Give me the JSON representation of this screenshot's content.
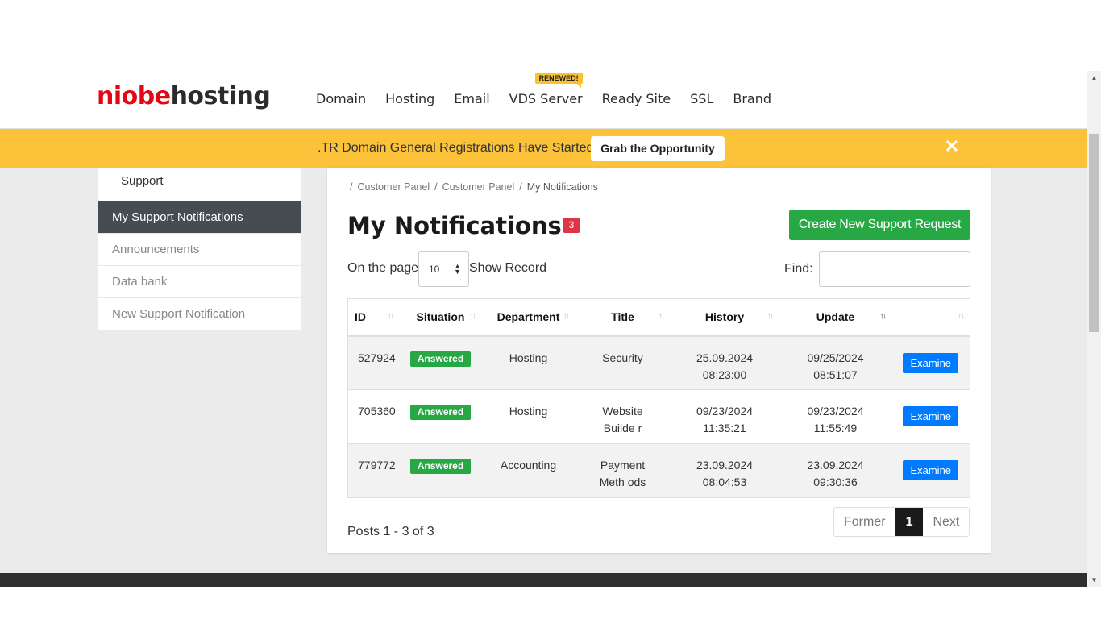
{
  "logo": {
    "part1": "niobe",
    "part2": "hosting"
  },
  "nav": {
    "items": [
      "Domain",
      "Hosting",
      "Email",
      "VDS Server",
      "Ready Site",
      "SSL",
      "Brand"
    ],
    "badge": "RENEWED!"
  },
  "promo": {
    "text": ".TR Domain General Registrations Have Started",
    "button": "Grab the Opportunity",
    "close": "✕"
  },
  "sidebar": {
    "support": "Support",
    "items": [
      "My Support Notifications",
      "Announcements",
      "Data bank",
      "New Support Notification"
    ]
  },
  "breadcrumb": [
    "Customer Panel",
    "Customer Panel",
    "My Notifications"
  ],
  "page": {
    "title": "My Notifications",
    "count": "3",
    "create_button": "Create New Support Request",
    "length_label": "On the page",
    "length_value": "10",
    "length_after": "Show Record",
    "find_label": "Find:"
  },
  "table": {
    "headers": [
      "ID",
      "Situation",
      "Department",
      "Title",
      "History",
      "Update",
      ""
    ],
    "rows": [
      {
        "id": "527924",
        "status": "Answered",
        "department": "Hosting",
        "title": "Security",
        "history_date": "25.09.2024",
        "history_time": "08:23:00",
        "update_date": "09/25/2024",
        "update_time": "08:51:07",
        "action": "Examine"
      },
      {
        "id": "705360",
        "status": "Answered",
        "department": "Hosting",
        "title": "Website Builde r",
        "history_date": "09/23/2024",
        "history_time": "11:35:21",
        "update_date": "09/23/2024",
        "update_time": "11:55:49",
        "action": "Examine"
      },
      {
        "id": "779772",
        "status": "Answered",
        "department": "Accounting",
        "title": "Payment Meth ods",
        "history_date": "23.09.2024",
        "history_time": "08:04:53",
        "update_date": "23.09.2024",
        "update_time": "09:30:36",
        "action": "Examine"
      }
    ]
  },
  "footer": {
    "posts": "Posts 1 - 3 of 3",
    "pager": {
      "prev": "Former",
      "current": "1",
      "next": "Next"
    }
  },
  "colors": {
    "accent": "#fcc23a",
    "brand_red": "#e30613",
    "success": "#28a745",
    "primary": "#007bff",
    "danger": "#dc3545"
  }
}
